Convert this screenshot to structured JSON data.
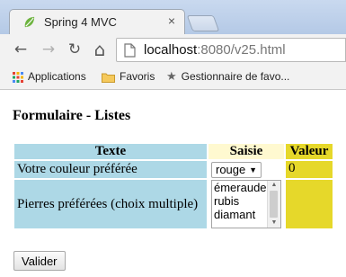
{
  "browser": {
    "tab_title": "Spring 4 MVC",
    "tab_close": "×",
    "url_host": "localhost",
    "url_rest": ":8080/v25.html",
    "nav": {
      "back": "←",
      "forward": "→",
      "reload": "↻",
      "home": "⌂"
    },
    "bookmarks": [
      {
        "label": "Applications",
        "icon": "apps-grid-icon"
      },
      {
        "label": "Favoris",
        "icon": "folder-icon"
      },
      {
        "label": "Gestionnaire de favo...",
        "icon": "star-icon"
      }
    ]
  },
  "page": {
    "title": "Formulaire - Listes",
    "headers": {
      "texte": "Texte",
      "saisie": "Saisie",
      "valeur": "Valeur"
    },
    "rows": [
      {
        "label": "Votre couleur préférée",
        "select_value": "rouge",
        "valeur": "0"
      },
      {
        "label": "Pierres préférées (choix multiple)",
        "options": [
          "émeraude",
          "rubis",
          "diamant"
        ],
        "valeur": ""
      }
    ],
    "submit_label": "Valider"
  },
  "colors": {
    "header_texte": "#add8e6",
    "header_saisie": "#fff9d0",
    "valeur": "#e6d82a"
  }
}
